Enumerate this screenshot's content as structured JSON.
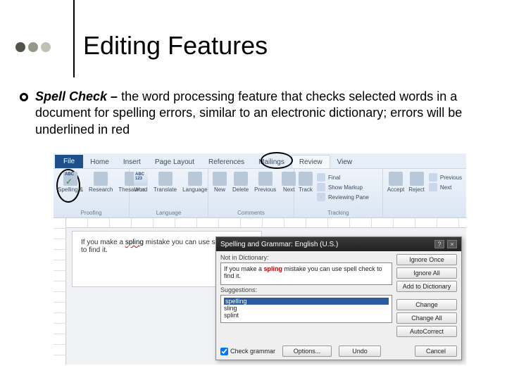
{
  "slide": {
    "title": "Editing Features",
    "bullet_strong": "Spell Check –",
    "bullet_rest": " the word processing feature that checks selected words in a document for spelling errors, similar to an electronic dictionary; errors will be underlined in red"
  },
  "ribbon": {
    "tabs": {
      "file": "File",
      "home": "Home",
      "insert": "Insert",
      "page_layout": "Page Layout",
      "references": "References",
      "mailings": "Mailings",
      "review": "Review",
      "view": "View"
    },
    "proofing": {
      "spelling": "Spelling &",
      "research": "Research",
      "thesaurus": "Thesaurus",
      "label": "Proofing"
    },
    "language": {
      "word_count": "Word\nCount",
      "translate": "Translate",
      "language": "Language",
      "label": "Language"
    },
    "comments": {
      "new": "New",
      "delete": "Delete",
      "previous": "Previous",
      "next": "Next",
      "label": "Comments"
    },
    "tracking": {
      "track": "Track",
      "final": "Final",
      "show_markup": "Show Markup",
      "reviewing_pane": "Reviewing Pane",
      "label": "Tracking"
    },
    "changes": {
      "accept": "Accept",
      "reject": "Reject",
      "previous": "Previous",
      "next": "Next",
      "label": ""
    },
    "count_label": "123"
  },
  "doc": {
    "line1_a": "If you make a ",
    "line1_err": "spling",
    "line1_b": " mistake you can use spell check to find it."
  },
  "dialog": {
    "title": "Spelling and Grammar: English (U.S.)",
    "not_in_dict": "Not in Dictionary:",
    "sentence_a": "If you make a ",
    "sentence_err": "spling",
    "sentence_b": " mistake you can use spell check to find it.",
    "suggestions_label": "Suggestions:",
    "suggestions": [
      "spelling",
      "sling",
      "splint"
    ],
    "btn_ignore_once": "Ignore Once",
    "btn_ignore_all": "Ignore All",
    "btn_add": "Add to Dictionary",
    "btn_change": "Change",
    "btn_change_all": "Change All",
    "btn_autocorrect": "AutoCorrect",
    "check_grammar": "Check grammar",
    "btn_options": "Options...",
    "btn_undo": "Undo",
    "btn_cancel": "Cancel"
  }
}
